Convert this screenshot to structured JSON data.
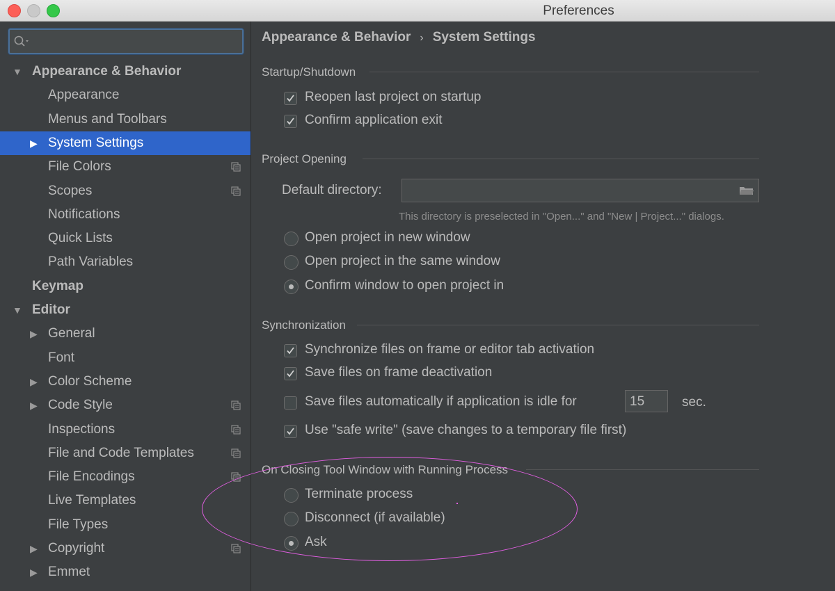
{
  "window": {
    "title": "Preferences"
  },
  "search": {
    "placeholder": "",
    "value": ""
  },
  "sidebar": {
    "items": [
      {
        "label": "Appearance & Behavior",
        "level": 0,
        "expander": "expanded",
        "bold": true
      },
      {
        "label": "Appearance",
        "level": 1
      },
      {
        "label": "Menus and Toolbars",
        "level": 1
      },
      {
        "label": "System Settings",
        "level": 1,
        "expander": "collapsed",
        "selected": true
      },
      {
        "label": "File Colors",
        "level": 1,
        "copy_icon": true
      },
      {
        "label": "Scopes",
        "level": 1,
        "copy_icon": true
      },
      {
        "label": "Notifications",
        "level": 1
      },
      {
        "label": "Quick Lists",
        "level": 1
      },
      {
        "label": "Path Variables",
        "level": 1
      },
      {
        "label": "Keymap",
        "level": 0,
        "bold": true
      },
      {
        "label": "Editor",
        "level": 0,
        "expander": "expanded",
        "bold": true
      },
      {
        "label": "General",
        "level": 1,
        "expander": "collapsed"
      },
      {
        "label": "Font",
        "level": 1
      },
      {
        "label": "Color Scheme",
        "level": 1,
        "expander": "collapsed"
      },
      {
        "label": "Code Style",
        "level": 1,
        "expander": "collapsed",
        "copy_icon": true
      },
      {
        "label": "Inspections",
        "level": 1,
        "copy_icon": true
      },
      {
        "label": "File and Code Templates",
        "level": 1,
        "copy_icon": true
      },
      {
        "label": "File Encodings",
        "level": 1,
        "copy_icon": true
      },
      {
        "label": "Live Templates",
        "level": 1
      },
      {
        "label": "File Types",
        "level": 1
      },
      {
        "label": "Copyright",
        "level": 1,
        "expander": "collapsed",
        "copy_icon": true
      },
      {
        "label": "Emmet",
        "level": 1,
        "expander": "collapsed"
      }
    ]
  },
  "breadcrumb": {
    "parent": "Appearance & Behavior",
    "separator": "›",
    "current": "System Settings"
  },
  "startup": {
    "title": "Startup/Shutdown",
    "reopen_label": "Reopen last project on startup",
    "reopen_checked": true,
    "confirm_exit_label": "Confirm application exit",
    "confirm_exit_checked": true
  },
  "project_opening": {
    "title": "Project Opening",
    "default_dir_label": "Default directory:",
    "default_dir_value": "",
    "hint": "This directory is preselected in \"Open...\" and \"New | Project...\" dialogs.",
    "options": [
      "Open project in new window",
      "Open project in the same window",
      "Confirm window to open project in"
    ],
    "selected": "Confirm window to open project in"
  },
  "sync": {
    "title": "Synchronization",
    "sync_files_label": "Synchronize files on frame or editor tab activation",
    "sync_files_checked": true,
    "save_deactivation_label": "Save files on frame deactivation",
    "save_deactivation_checked": true,
    "save_idle_label": "Save files automatically if application is idle for",
    "save_idle_checked": false,
    "idle_seconds": "15",
    "idle_unit": "sec.",
    "safe_write_label": "Use \"safe write\" (save changes to a temporary file first)",
    "safe_write_checked": true
  },
  "closing": {
    "title": "On Closing Tool Window with Running Process",
    "options": [
      "Terminate process",
      "Disconnect (if available)",
      "Ask"
    ],
    "selected": "Ask"
  },
  "colors": {
    "background": "#3c3f41",
    "selection": "#2f65ca",
    "text": "#bbbbbb",
    "annotation": "#e35fe3"
  }
}
